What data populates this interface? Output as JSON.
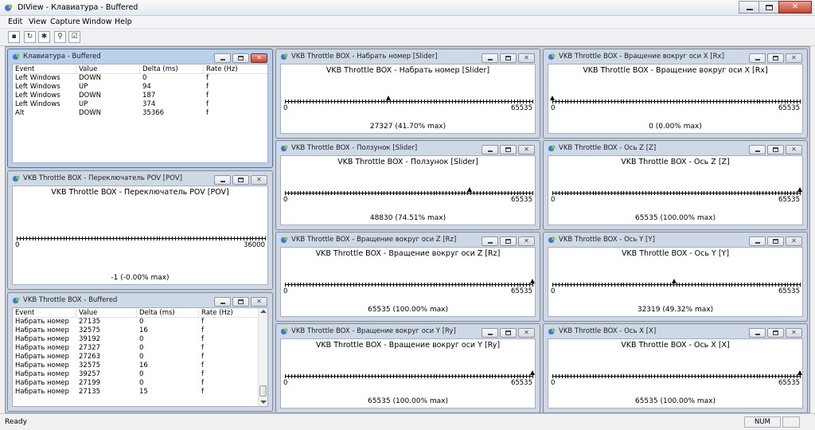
{
  "app": {
    "title": "DIView - Клавиатура - Buffered"
  },
  "menu": [
    "Edit",
    "View",
    "Capture",
    "Window",
    "Help"
  ],
  "toolbar": [
    {
      "name": "save-icon",
      "glyph": "▪"
    },
    {
      "name": "refresh-icon",
      "glyph": "↻"
    },
    {
      "name": "settings-icon",
      "glyph": "✱"
    },
    {
      "name": "search-icon",
      "glyph": "⚲"
    },
    {
      "name": "properties-icon",
      "glyph": "☑"
    }
  ],
  "keyboard_window": {
    "title": "Клавиатура - Buffered",
    "columns": [
      "Event",
      "Value",
      "Delta (ms)",
      "Rate (Hz)"
    ],
    "rows": [
      [
        "Left Windows",
        "DOWN",
        "0",
        "f"
      ],
      [
        "Left Windows",
        "UP",
        "94",
        "f"
      ],
      [
        "Left Windows",
        "DOWN",
        "187",
        "f"
      ],
      [
        "Left Windows",
        "UP",
        "374",
        "f"
      ],
      [
        "Alt",
        "DOWN",
        "35366",
        "f"
      ]
    ]
  },
  "vkb_buffered": {
    "title": "VKB Throttle BOX - Buffered",
    "columns": [
      "Event",
      "Value",
      "Delta (ms)",
      "Rate (Hz)"
    ],
    "rows": [
      [
        "Набрать номер",
        "27135",
        "0",
        "f"
      ],
      [
        "Набрать номер",
        "32575",
        "16",
        "f"
      ],
      [
        "Набрать номер",
        "39192",
        "0",
        "f"
      ],
      [
        "Набрать номер",
        "27327",
        "0",
        "f"
      ],
      [
        "Набрать номер",
        "27263",
        "0",
        "f"
      ],
      [
        "Набрать номер",
        "32575",
        "16",
        "f"
      ],
      [
        "Набрать номер",
        "39257",
        "0",
        "f"
      ],
      [
        "Набрать номер",
        "27199",
        "0",
        "f"
      ],
      [
        "Набрать номер",
        "27135",
        "15",
        "f"
      ]
    ]
  },
  "axes": {
    "pov": {
      "title": "VKB Throttle BOX - Переключатель POV [POV]",
      "header": "VKB Throttle BOX  - Переключатель POV [POV]",
      "min": "0",
      "max": "36000",
      "value": "-1 (-0.00% max)",
      "fraction": -1
    },
    "dial": {
      "title": "VKB Throttle BOX - Набрать номер [Slider]",
      "header": "VKB Throttle BOX  - Набрать номер [Slider]",
      "min": "0",
      "max": "65535",
      "value": "27327 (41.70% max)",
      "fraction": 0.417
    },
    "rx": {
      "title": "VKB Throttle BOX - Вращение вокруг оси X [Rx]",
      "header": "VKB Throttle BOX  - Вращение вокруг оси X [Rx]",
      "min": "0",
      "max": "65535",
      "value": "0 (0.00% max)",
      "fraction": 0
    },
    "slider": {
      "title": "VKB Throttle BOX - Ползунок [Slider]",
      "header": "VKB Throttle BOX  - Ползунок [Slider]",
      "min": "0",
      "max": "65535",
      "value": "48830 (74.51% max)",
      "fraction": 0.7451
    },
    "z": {
      "title": "VKB Throttle BOX - Ось Z [Z]",
      "header": "VKB Throttle BOX  - Ось Z [Z]",
      "min": "0",
      "max": "65535",
      "value": "65535 (100.00% max)",
      "fraction": 1
    },
    "rz": {
      "title": "VKB Throttle BOX - Вращение вокруг оси Z [Rz]",
      "header": "VKB Throttle BOX  - Вращение вокруг оси Z [Rz]",
      "min": "0",
      "max": "65535",
      "value": "65535 (100.00% max)",
      "fraction": 1
    },
    "y": {
      "title": "VKB Throttle BOX - Ось Y [Y]",
      "header": "VKB Throttle BOX  - Ось Y [Y]",
      "min": "0",
      "max": "65535",
      "value": "32319 (49.32% max)",
      "fraction": 0.4932
    },
    "ry": {
      "title": "VKB Throttle BOX - Вращение вокруг оси Y [Ry]",
      "header": "VKB Throttle BOX  - Вращение вокруг оси Y [Ry]",
      "min": "0",
      "max": "65535",
      "value": "65535 (100.00% max)",
      "fraction": 1
    },
    "x": {
      "title": "VKB Throttle BOX - Ось X [X]",
      "header": "VKB Throttle BOX  - Ось X [X]",
      "min": "0",
      "max": "65535",
      "value": "65535 (100.00% max)",
      "fraction": 1
    }
  },
  "status": {
    "ready": "Ready",
    "num": "NUM"
  }
}
